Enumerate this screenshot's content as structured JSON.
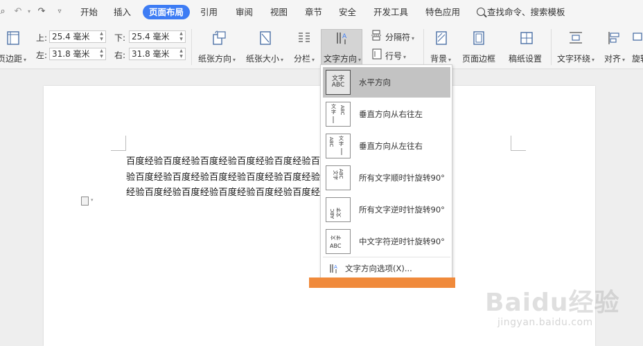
{
  "menubar": {
    "tabs": [
      {
        "label": "开始"
      },
      {
        "label": "插入"
      },
      {
        "label": "页面布局"
      },
      {
        "label": "引用"
      },
      {
        "label": "审阅"
      },
      {
        "label": "视图"
      },
      {
        "label": "章节"
      },
      {
        "label": "安全"
      },
      {
        "label": "开发工具"
      },
      {
        "label": "特色应用"
      }
    ],
    "active_tab": "页面布局",
    "search_label": "查找命令、搜索模板"
  },
  "ribbon": {
    "margins_label": "页边距",
    "top_label": "上:",
    "top_value": "25.4 毫米",
    "bottom_label": "下:",
    "bottom_value": "25.4 毫米",
    "left_label": "左:",
    "left_value": "31.8 毫米",
    "right_label": "右:",
    "right_value": "31.8 毫米",
    "orientation_label": "纸张方向",
    "size_label": "纸张大小",
    "columns_label": "分栏",
    "text_direction_label": "文字方向",
    "breaks_label": "分隔符",
    "line_numbers_label": "行号",
    "background_label": "背景",
    "page_border_label": "页面边框",
    "manuscript_label": "稿纸设置",
    "wrap_label": "文字环绕",
    "align_label": "对齐",
    "rotate_label": "旋转"
  },
  "document": {
    "lines": [
      "百度经验百度经验百度经验百度经验百度经验百度经验百度经验百度经验百度经",
      "验百度经验百度经验百度经验百度经验百度经验百度经验百度经验百度经验百度",
      "经验百度经验百度经验百度经验百度经验百度经验百度经验百度经验。"
    ]
  },
  "dropdown": {
    "items": [
      {
        "label": "水平方向",
        "thumb": "文字ABC",
        "selected": true
      },
      {
        "label": "垂直方向从右往左",
        "thumb": "ABC文字",
        "selected": false
      },
      {
        "label": "垂直方向从左往右",
        "thumb": "ABC文字",
        "selected": false
      },
      {
        "label": "所有文字顺时针旋转90°",
        "thumb": "ABC文字",
        "selected": false
      },
      {
        "label": "所有文字逆时针旋转90°",
        "thumb": "ABC文字",
        "selected": false
      },
      {
        "label": "中文字符逆时针旋转90°",
        "thumb": "文字ABC",
        "selected": false
      }
    ],
    "options_label": "文字方向选项(X)..."
  },
  "watermark": {
    "logo": "Baidu经验",
    "url": "jingyan.baidu.com"
  },
  "colors": {
    "accent": "#3d7cf4",
    "orange_highlight": "#f08a3b",
    "selected_item": "#c3c3c3"
  }
}
